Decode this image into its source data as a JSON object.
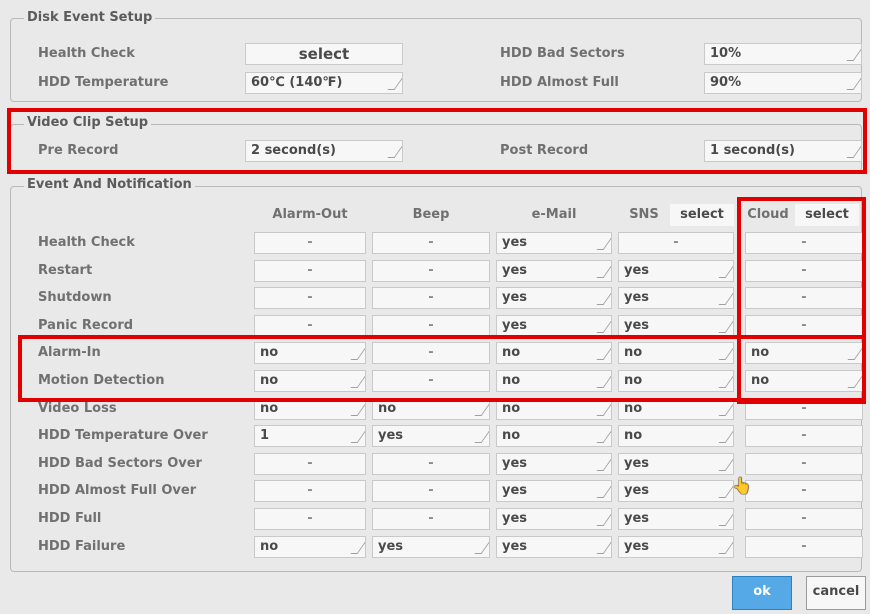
{
  "disk": {
    "title": "Disk Event Setup",
    "health_check_label": "Health Check",
    "health_check_btn": "select",
    "hdd_temp_label": "HDD Temperature",
    "hdd_temp_value": "60℃ (140℉)",
    "bad_sectors_label": "HDD Bad Sectors",
    "bad_sectors_value": "10%",
    "almost_full_label": "HDD Almost Full",
    "almost_full_value": "90%"
  },
  "video": {
    "title": "Video Clip Setup",
    "pre_label": "Pre Record",
    "pre_value": "2 second(s)",
    "post_label": "Post Record",
    "post_value": "1 second(s)"
  },
  "notify": {
    "title": "Event And Notification",
    "col_alarm": "Alarm-Out",
    "col_beep": "Beep",
    "col_email": "e-Mail",
    "col_sns": "SNS",
    "sns_select": "select",
    "col_cloud": "Cloud",
    "cloud_select": "select",
    "rows": [
      {
        "label": "Health Check",
        "alarm": "-",
        "beep": "-",
        "email": "yes",
        "sns": "-",
        "cloud": "-"
      },
      {
        "label": "Restart",
        "alarm": "-",
        "beep": "-",
        "email": "yes",
        "sns": "yes",
        "cloud": "-"
      },
      {
        "label": "Shutdown",
        "alarm": "-",
        "beep": "-",
        "email": "yes",
        "sns": "yes",
        "cloud": "-"
      },
      {
        "label": "Panic Record",
        "alarm": "-",
        "beep": "-",
        "email": "yes",
        "sns": "yes",
        "cloud": "-"
      },
      {
        "label": "Alarm-In",
        "alarm": "no",
        "beep": "-",
        "email": "no",
        "sns": "no",
        "cloud": "no"
      },
      {
        "label": "Motion Detection",
        "alarm": "no",
        "beep": "-",
        "email": "no",
        "sns": "no",
        "cloud": "no"
      },
      {
        "label": "Video Loss",
        "alarm": "no",
        "beep": "no",
        "email": "no",
        "sns": "no",
        "cloud": "-"
      },
      {
        "label": "HDD Temperature Over",
        "alarm": "1",
        "beep": "yes",
        "email": "no",
        "sns": "no",
        "cloud": "-"
      },
      {
        "label": "HDD Bad Sectors Over",
        "alarm": "-",
        "beep": "-",
        "email": "yes",
        "sns": "yes",
        "cloud": "-"
      },
      {
        "label": "HDD Almost Full Over",
        "alarm": "-",
        "beep": "-",
        "email": "yes",
        "sns": "yes",
        "cloud": "-"
      },
      {
        "label": "HDD Full",
        "alarm": "-",
        "beep": "-",
        "email": "yes",
        "sns": "yes",
        "cloud": "-"
      },
      {
        "label": "HDD Failure",
        "alarm": "no",
        "beep": "yes",
        "email": "yes",
        "sns": "yes",
        "cloud": "-"
      }
    ]
  },
  "buttons": {
    "ok": "ok",
    "cancel": "cancel"
  },
  "colors": {
    "highlight": "#e00000",
    "ok_button": "#55a9e6",
    "background": "#e9e9e9"
  }
}
